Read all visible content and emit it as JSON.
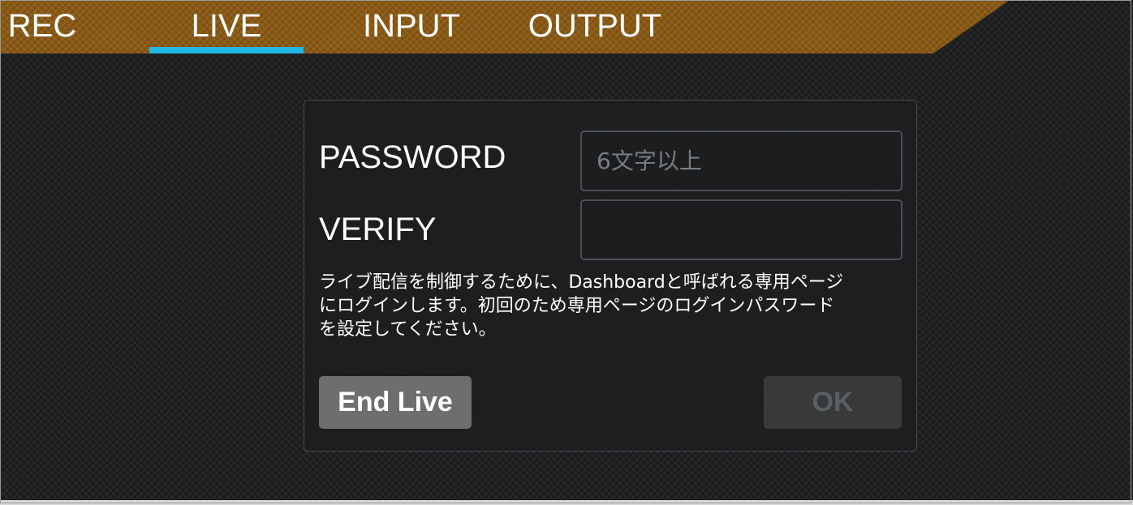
{
  "tabs": [
    {
      "label": "REC",
      "active": false
    },
    {
      "label": "LIVE",
      "active": true
    },
    {
      "label": "INPUT",
      "active": false
    },
    {
      "label": "OUTPUT",
      "active": false
    }
  ],
  "dialog": {
    "password_label": "PASSWORD",
    "password_placeholder": "6文字以上",
    "password_value": "",
    "verify_label": "VERIFY",
    "verify_value": "",
    "message_lines": [
      "ライブ配信を制御するために、Dashboardと呼ばれる専用ページ",
      "にログインします。初回のため専用ページのログインパスワード",
      "を設定してください。"
    ],
    "end_live_label": "End Live",
    "ok_label": "OK"
  },
  "colors": {
    "header_bg": "#8a5a14",
    "active_tab_indicator": "#22b8e6",
    "background": "#1f2123"
  }
}
